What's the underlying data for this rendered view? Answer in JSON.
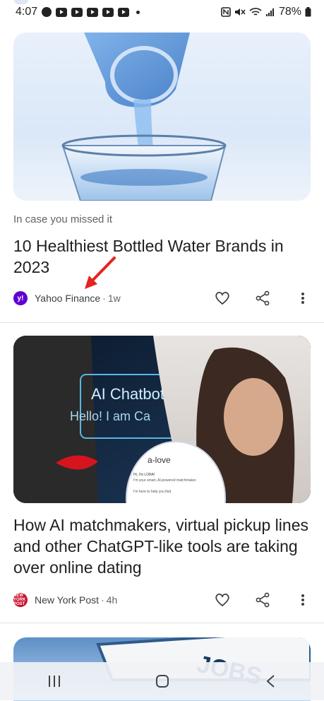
{
  "status_bar": {
    "time": "4:07",
    "battery": "78%",
    "notification_icons": [
      "facebook-icon",
      "youtube-icon",
      "youtube-icon",
      "youtube-icon",
      "youtube-icon",
      "youtube-icon"
    ],
    "system_icons": [
      "nfc-icon",
      "mute-icon",
      "wifi-icon",
      "signal-icon",
      "battery-icon"
    ]
  },
  "feed": [
    {
      "kicker": "In case you missed it",
      "headline": "10 Healthiest Bottled Water Brands in 2023",
      "source": "Yahoo Finance",
      "source_logo_text": "y!",
      "separator": "·",
      "age": "1w",
      "image_desc_icon": "water-glass-image"
    },
    {
      "headline": "How AI matchmakers, virtual pickup lines and other ChatGPT-like tools are taking over online dating",
      "source": "New York Post",
      "source_logo_text": "NEW YORK POST",
      "separator": "·",
      "age": "4h",
      "image_overlay": {
        "chatbot_line1": "AI Chatbot",
        "chatbot_line2": "Hello! I am Ca",
        "phone_title": "a-love",
        "phone_msg1": "Hi, I'm LORA!",
        "phone_msg2": "I'm your smart, AI-powered matchmaker.",
        "phone_msg3": "I'm here to help you find"
      }
    },
    {
      "image_sign_text": "JOBS"
    }
  ],
  "colors": {
    "accent_arrow": "#e4231f",
    "yahoo_purple": "#6001d2",
    "nyp_red": "#c8102e"
  }
}
